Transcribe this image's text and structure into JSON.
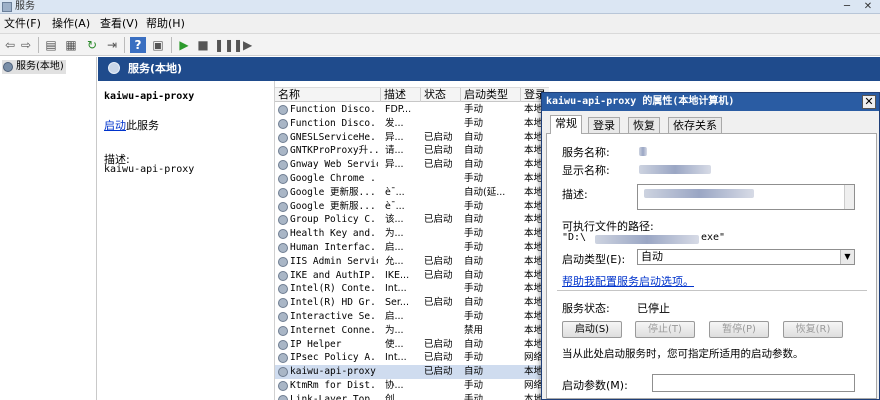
{
  "window": {
    "title": "服务",
    "minimize": "─",
    "close": "✕"
  },
  "menu": [
    "文件(F)",
    "操作(A)",
    "查看(V)",
    "帮助(H)"
  ],
  "toolbar_icons": [
    "back-icon",
    "forward-icon",
    "show-tree-icon",
    "properties-icon",
    "refresh-icon",
    "export-icon",
    "help-icon",
    "console-icon",
    "start-icon",
    "stop-icon",
    "pause-icon",
    "restart-icon"
  ],
  "tree": {
    "root": "服务(本地)"
  },
  "header": {
    "title": "服务(本地)"
  },
  "detail": {
    "service_name": "kaiwu-api-proxy",
    "action_link": "启动",
    "action_suffix": "此服务",
    "desc_label": "描述:",
    "desc_value": "kaiwu-api-proxy"
  },
  "columns": [
    "名称",
    "描述",
    "状态",
    "启动类型",
    "登录"
  ],
  "rows": [
    {
      "name": "Function Disco...",
      "desc": "FDP...",
      "status": "",
      "startup": "手动",
      "logon": "本地"
    },
    {
      "name": "Function Disco...",
      "desc": "发...",
      "status": "",
      "startup": "手动",
      "logon": "本地"
    },
    {
      "name": "GNESLServiceHe...",
      "desc": "异...",
      "status": "已启动",
      "startup": "自动",
      "logon": "本地"
    },
    {
      "name": "GNTKProProxy升...",
      "desc": "请...",
      "status": "已启动",
      "startup": "自动",
      "logon": "本地"
    },
    {
      "name": "Gnway Web Service",
      "desc": "异...",
      "status": "已启动",
      "startup": "自动",
      "logon": "本地"
    },
    {
      "name": "Google Chrome ...",
      "desc": "",
      "status": "",
      "startup": "手动",
      "logon": "本地"
    },
    {
      "name": "Google 更新服...",
      "desc": "è¯...",
      "status": "",
      "startup": "自动(延...",
      "logon": "本地"
    },
    {
      "name": "Google 更新服...",
      "desc": "è¯...",
      "status": "",
      "startup": "手动",
      "logon": "本地"
    },
    {
      "name": "Group Policy C...",
      "desc": "该...",
      "status": "已启动",
      "startup": "自动",
      "logon": "本地"
    },
    {
      "name": "Health Key and...",
      "desc": "为...",
      "status": "",
      "startup": "手动",
      "logon": "本地"
    },
    {
      "name": "Human Interfac...",
      "desc": "启...",
      "status": "",
      "startup": "手动",
      "logon": "本地"
    },
    {
      "name": "IIS Admin Service",
      "desc": "允...",
      "status": "已启动",
      "startup": "自动",
      "logon": "本地"
    },
    {
      "name": "IKE and AuthIP...",
      "desc": "IKE...",
      "status": "已启动",
      "startup": "自动",
      "logon": "本地"
    },
    {
      "name": "Intel(R) Conte...",
      "desc": "Int...",
      "status": "",
      "startup": "手动",
      "logon": "本地"
    },
    {
      "name": "Intel(R) HD Gr...",
      "desc": "Ser...",
      "status": "已启动",
      "startup": "自动",
      "logon": "本地"
    },
    {
      "name": "Interactive Se...",
      "desc": "启...",
      "status": "",
      "startup": "手动",
      "logon": "本地"
    },
    {
      "name": "Internet Conne...",
      "desc": "为...",
      "status": "",
      "startup": "禁用",
      "logon": "本地"
    },
    {
      "name": "IP Helper",
      "desc": "使...",
      "status": "已启动",
      "startup": "自动",
      "logon": "本地"
    },
    {
      "name": "IPsec Policy A...",
      "desc": "Int...",
      "status": "已启动",
      "startup": "手动",
      "logon": "网络"
    },
    {
      "name": "kaiwu-api-proxy",
      "desc": "",
      "status": "已启动",
      "startup": "自动",
      "logon": "本地"
    },
    {
      "name": "KtmRm for Dist...",
      "desc": "协...",
      "status": "",
      "startup": "手动",
      "logon": "网络"
    },
    {
      "name": "Link-Layer Top...",
      "desc": "创...",
      "status": "",
      "startup": "手动",
      "logon": "本地"
    }
  ],
  "dialog": {
    "title": "kaiwu-api-proxy 的属性(本地计算机)",
    "close": "✕",
    "tabs": [
      "常规",
      "登录",
      "恢复",
      "依存关系"
    ],
    "service_name_label": "服务名称:",
    "display_name_label": "显示名称:",
    "desc_label": "描述:",
    "path_label": "可执行文件的路径:",
    "path_value": "\"D:\\",
    "path_value_end": "exe\"",
    "startup_type_label": "启动类型(E):",
    "startup_type_value": "自动",
    "help_link": "帮助我配置服务启动选项。",
    "status_label": "服务状态:",
    "status_value": "已停止",
    "buttons": [
      "启动(S)",
      "停止(T)",
      "暂停(P)",
      "恢复(R)"
    ],
    "hint": "当从此处启动服务时，您可指定所适用的启动参数。",
    "params_label": "启动参数(M):"
  }
}
